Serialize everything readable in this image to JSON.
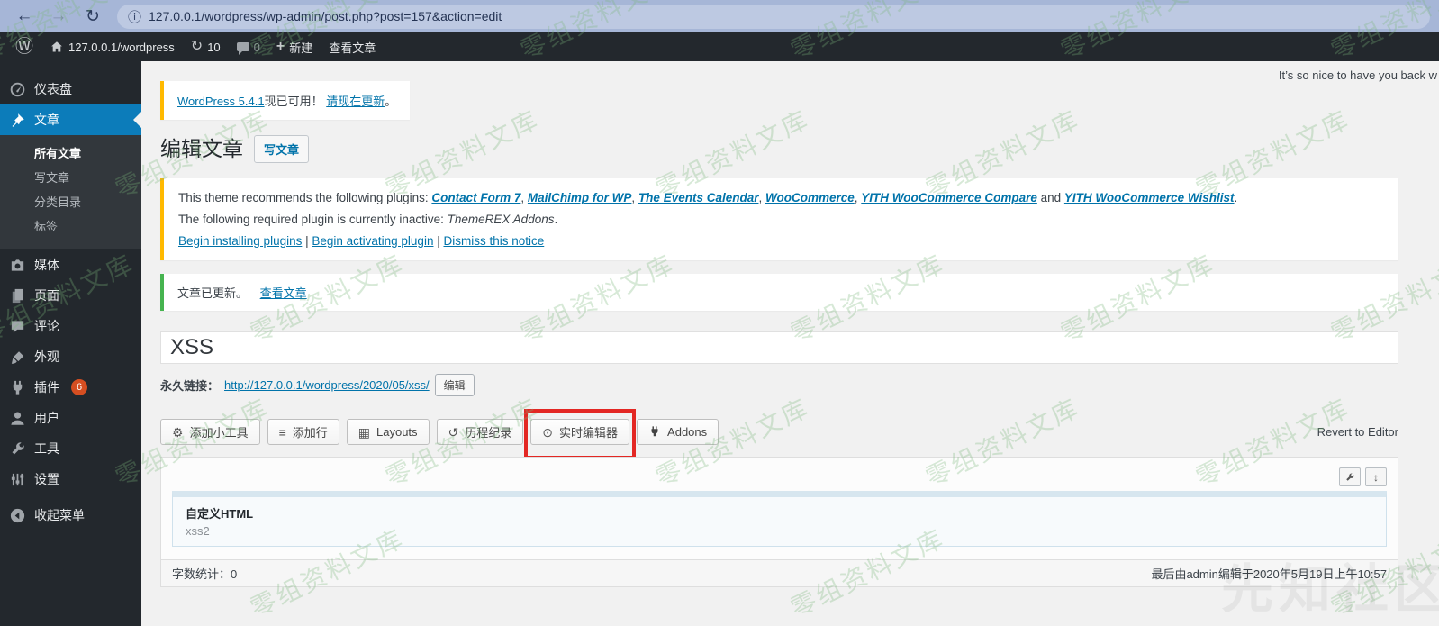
{
  "browser": {
    "url": "127.0.0.1/wordpress/wp-admin/post.php?post=157&action=edit"
  },
  "icons": {
    "back": "←",
    "forward": "→",
    "refresh": "↻",
    "info": "ⓘ",
    "wp_logo": "Ⓦ",
    "plus": "+",
    "update": "↻",
    "gear": "⚙",
    "rows": "≡",
    "layouts": "▦",
    "history": "↺",
    "live_editor": "⊙",
    "resize": "↕",
    "sidebar_icon_names": [
      "gauge-icon",
      "pushpin-icon",
      "media-icon",
      "pages-icon",
      "comment-icon",
      "brush-icon",
      "plug-icon",
      "user-icon",
      "wrench-icon",
      "sliders-icon",
      "collapse-arrow-icon"
    ]
  },
  "admin_bar": {
    "site_name": "127.0.0.1/wordpress",
    "update_count": "10",
    "comment_count": "0",
    "new_label": "新建",
    "view_post_label": "查看文章"
  },
  "sidebar": {
    "items": [
      {
        "label": "仪表盘"
      },
      {
        "label": "文章"
      },
      {
        "label": "媒体"
      },
      {
        "label": "页面"
      },
      {
        "label": "评论"
      },
      {
        "label": "外观"
      },
      {
        "label": "插件",
        "badge": "6"
      },
      {
        "label": "用户"
      },
      {
        "label": "工具"
      },
      {
        "label": "设置"
      },
      {
        "label": "收起菜单"
      }
    ],
    "submenu": [
      {
        "label": "所有文章"
      },
      {
        "label": "写文章"
      },
      {
        "label": "分类目录"
      },
      {
        "label": "标签"
      }
    ]
  },
  "greeting": "It’s so nice to have you back w",
  "update_notice": {
    "link_version": "WordPress 5.4.1",
    "text_available": "现已可用！ ",
    "link_update": "请现在更新",
    "period": "。"
  },
  "page_header": {
    "title": "编辑文章",
    "add_new": "写文章"
  },
  "theme_notice": {
    "intro": "This theme recommends the following plugins: ",
    "plugins": [
      "Contact Form 7",
      "MailChimp for WP",
      "The Events Calendar",
      "WooCommerce",
      "YITH WooCommerce Compare",
      "YITH WooCommerce Wishlist"
    ],
    "seps": {
      "comma": ", ",
      "and": " and ",
      "period": ".",
      "pipe": " | "
    },
    "line2_text": "The following required plugin is currently inactive: ",
    "line2_plugin": "ThemeREX Addons",
    "line2_period": ".",
    "actions": [
      "Begin installing plugins",
      "Begin activating plugin",
      "Dismiss this notice"
    ]
  },
  "updated_notice": {
    "text": "文章已更新。",
    "link": "查看文章"
  },
  "post": {
    "title": "XSS"
  },
  "permalink": {
    "label": "永久链接：",
    "url": "http://127.0.0.1/wordpress/2020/05/xss/",
    "edit_button": "编辑"
  },
  "editor": {
    "toolbar": [
      {
        "label": "添加小工具"
      },
      {
        "label": "添加行"
      },
      {
        "label": "Layouts"
      },
      {
        "label": "历程纪录"
      },
      {
        "label": "实时编辑器"
      },
      {
        "label": "Addons"
      }
    ],
    "revert_label": "Revert to Editor",
    "widget": {
      "title": "自定义HTML",
      "content": "xss2"
    }
  },
  "status": {
    "word_count_label": "字数统计：",
    "word_count": "0",
    "last_edited": "最后由admin编辑于2020年5月19日上午10:57"
  },
  "watermark": {
    "text": "零组资料文库",
    "brand": "先知社区"
  },
  "colors": {
    "accent_link": "#0073aa",
    "menu_active": "#0c7cba",
    "warning_border": "#ffb900",
    "success_border": "#46b450",
    "highlight_red": "#e32723",
    "plugin_badge": "#d54e21",
    "admin_dark": "#23282d",
    "page_bg": "#f1f1f1",
    "browser_bar": "#a6b6d7"
  }
}
